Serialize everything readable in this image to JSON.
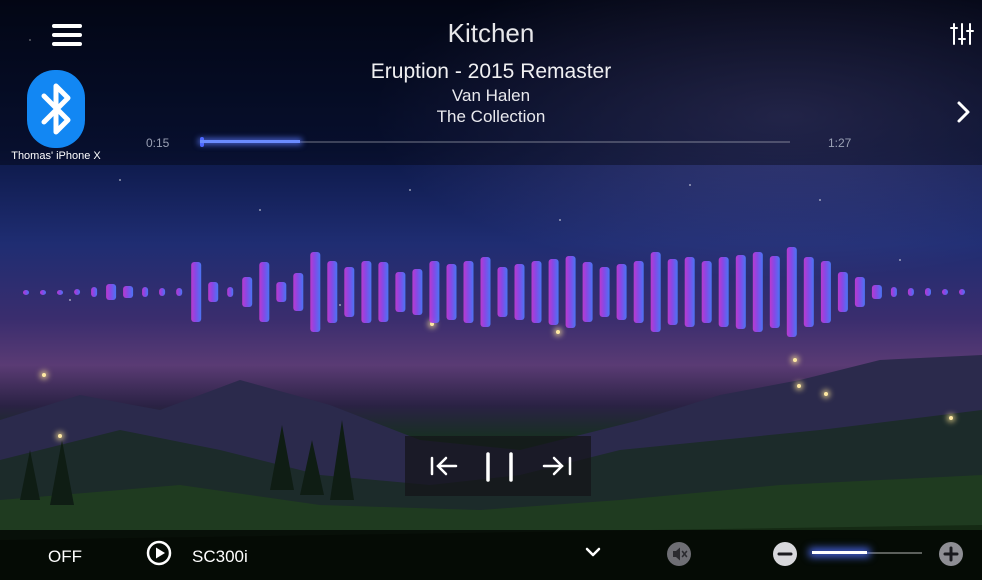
{
  "room": "Kitchen",
  "now_playing": {
    "track": "Eruption - 2015 Remaster",
    "artist": "Van Halen",
    "album": "The Collection",
    "elapsed": "0:15",
    "duration": "1:27",
    "progress_fraction": 0.17
  },
  "source_device": {
    "label": "Thomas' iPhone X",
    "icon": "bluetooth-icon",
    "color": "#1287f3"
  },
  "header_icons": [
    "menu-icon",
    "equalizer-icon",
    "chevron-right-icon"
  ],
  "transport_icons": [
    "skip-previous-icon",
    "pause-icon",
    "skip-next-icon"
  ],
  "bottom_bar": {
    "power_label": "OFF",
    "source_name": "SC300i",
    "icons": [
      "play-circle-icon",
      "chevron-down-icon",
      "mute-icon",
      "volume-minus-icon",
      "volume-plus-icon"
    ],
    "volume_fraction": 0.5
  },
  "accent_color": "#5a6cff"
}
